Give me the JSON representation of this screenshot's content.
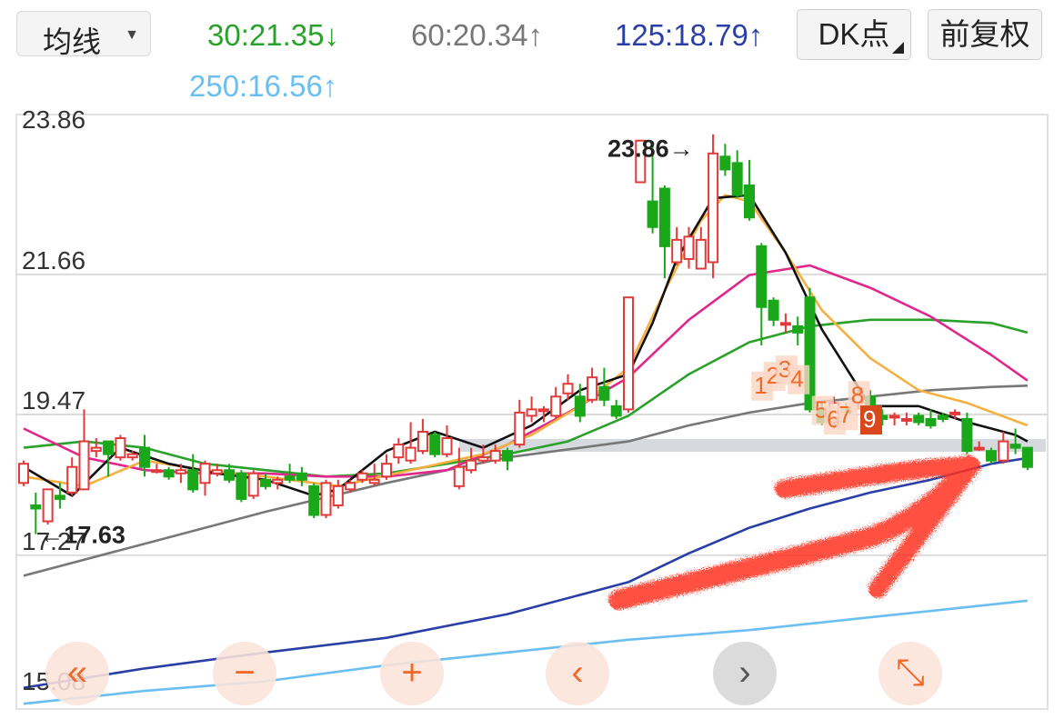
{
  "toolbar": {
    "indicator_select": {
      "label": "均线",
      "caret": "▼"
    },
    "ma": [
      {
        "label": "30:21.35↓",
        "color": "#2aa12a"
      },
      {
        "label": "60:20.34↑",
        "color": "#777777"
      },
      {
        "label": "125:18.79↑",
        "color": "#2a3fa6"
      },
      {
        "label": "250:16.56↑",
        "color": "#6bbff0"
      }
    ],
    "dk_button": "DK点",
    "adjust_button": "前复权"
  },
  "nav": [
    {
      "icon": "double-left-icon",
      "glyph": "«"
    },
    {
      "icon": "zoom-out-icon",
      "glyph": "−"
    },
    {
      "icon": "zoom-in-icon",
      "glyph": "+"
    },
    {
      "icon": "chevron-left-icon",
      "glyph": "‹"
    },
    {
      "icon": "chevron-right-icon",
      "glyph": "›"
    },
    {
      "icon": "expand-icon",
      "glyph": "⤡"
    }
  ],
  "chart_data": {
    "type": "candlestick",
    "y_ticks": [
      23.86,
      21.66,
      19.47,
      17.27,
      15.08
    ],
    "ylim": [
      15.08,
      23.86
    ],
    "grid": true,
    "colors": {
      "up": "#e03a3a",
      "down": "#1aa81a",
      "ma5": "#111111",
      "ma10": "#f5b040",
      "ma20": "#e0288c",
      "ma30": "#2aa12a",
      "ma60": "#777777",
      "ma125": "#2a3fa6",
      "ma250": "#6bbff0",
      "highlight": "#f06a2a",
      "arrow": "#ff3020"
    },
    "annotations": {
      "high": "23.86→",
      "low": "←17.63"
    },
    "td_labels": [
      {
        "text": "1",
        "n": 61,
        "y": 19.8,
        "style": "light"
      },
      {
        "text": "2",
        "n": 62,
        "y": 19.95,
        "style": "light"
      },
      {
        "text": "3",
        "n": 63,
        "y": 20.05,
        "style": "light"
      },
      {
        "text": "4",
        "n": 64,
        "y": 19.9,
        "style": "light"
      },
      {
        "text": "5",
        "n": 66,
        "y": 19.42,
        "style": "light"
      },
      {
        "text": "6",
        "n": 67,
        "y": 19.27,
        "style": "light"
      },
      {
        "text": "7",
        "n": 68,
        "y": 19.34,
        "style": "light"
      },
      {
        "text": "8",
        "n": 69,
        "y": 19.65,
        "style": "light"
      },
      {
        "text": "9",
        "n": 70,
        "y": 19.27,
        "style": "dark"
      }
    ],
    "candles": [
      [
        18.4,
        18.7,
        18.75,
        18.35
      ],
      [
        18.05,
        18.0,
        18.25,
        17.6
      ],
      [
        17.8,
        18.3,
        18.3,
        17.75
      ],
      [
        18.2,
        18.15,
        18.4,
        18.0
      ],
      [
        18.25,
        18.65,
        18.8,
        18.2
      ],
      [
        18.3,
        19.05,
        19.55,
        18.3
      ],
      [
        18.9,
        18.95,
        19.1,
        18.8
      ],
      [
        19.05,
        18.85,
        19.05,
        18.5
      ],
      [
        18.8,
        19.1,
        19.15,
        18.75
      ],
      [
        18.8,
        18.85,
        18.9,
        18.75
      ],
      [
        18.95,
        18.65,
        19.15,
        18.5
      ],
      [
        18.6,
        18.6,
        18.7,
        18.55
      ],
      [
        18.6,
        18.5,
        18.65,
        18.45
      ],
      [
        18.55,
        18.6,
        18.7,
        18.4
      ],
      [
        18.6,
        18.3,
        18.85,
        18.25
      ],
      [
        18.4,
        18.7,
        18.75,
        18.2
      ],
      [
        18.55,
        18.6,
        18.7,
        18.5
      ],
      [
        18.6,
        18.45,
        18.7,
        18.4
      ],
      [
        18.55,
        18.15,
        18.6,
        18.1
      ],
      [
        18.2,
        18.55,
        18.6,
        18.15
      ],
      [
        18.45,
        18.35,
        18.55,
        18.3
      ],
      [
        18.4,
        18.45,
        18.5,
        18.3
      ],
      [
        18.5,
        18.45,
        18.7,
        18.4
      ],
      [
        18.55,
        18.45,
        18.65,
        18.35
      ],
      [
        18.35,
        17.9,
        18.4,
        17.85
      ],
      [
        17.9,
        18.4,
        18.45,
        17.85
      ],
      [
        18.05,
        18.35,
        18.45,
        18.0
      ],
      [
        18.3,
        18.4,
        18.45,
        18.25
      ],
      [
        18.45,
        18.55,
        18.6,
        18.4
      ],
      [
        18.4,
        18.45,
        18.7,
        18.35
      ],
      [
        18.5,
        18.7,
        18.85,
        18.45
      ],
      [
        18.8,
        19.0,
        19.1,
        18.7
      ],
      [
        18.75,
        18.95,
        19.35,
        18.7
      ],
      [
        18.9,
        19.2,
        19.4,
        18.85
      ],
      [
        19.15,
        18.85,
        19.2,
        18.8
      ],
      [
        18.85,
        19.1,
        19.3,
        18.8
      ],
      [
        18.35,
        18.65,
        18.95,
        18.3
      ],
      [
        18.6,
        18.75,
        18.95,
        18.55
      ],
      [
        18.75,
        18.8,
        19.0,
        18.7
      ],
      [
        18.75,
        18.9,
        19.0,
        18.7
      ],
      [
        18.9,
        18.75,
        18.95,
        18.6
      ],
      [
        19.0,
        19.5,
        19.7,
        18.95
      ],
      [
        19.45,
        19.55,
        19.75,
        19.35
      ],
      [
        19.55,
        19.55,
        19.6,
        19.35
      ],
      [
        19.45,
        19.75,
        19.9,
        19.4
      ],
      [
        19.8,
        19.95,
        20.1,
        19.7
      ],
      [
        19.75,
        19.45,
        19.95,
        19.35
      ],
      [
        19.7,
        20.05,
        20.2,
        19.65
      ],
      [
        19.9,
        19.7,
        20.2,
        19.6
      ],
      [
        19.6,
        19.45,
        19.7,
        19.4
      ],
      [
        19.55,
        21.3,
        21.3,
        19.5
      ],
      [
        23.1,
        23.75,
        23.75,
        23.1
      ],
      [
        22.8,
        22.4,
        23.7,
        22.3
      ],
      [
        23.0,
        22.1,
        23.05,
        21.6
      ],
      [
        21.85,
        22.2,
        22.4,
        21.8
      ],
      [
        21.9,
        22.25,
        22.4,
        21.75
      ],
      [
        21.75,
        22.2,
        22.4,
        21.85
      ],
      [
        21.85,
        23.55,
        23.85,
        21.6
      ],
      [
        23.5,
        23.3,
        23.7,
        23.2
      ],
      [
        23.4,
        22.9,
        23.6,
        22.85
      ],
      [
        23.05,
        22.55,
        23.45,
        22.5
      ],
      [
        22.1,
        21.15,
        22.15,
        20.55
      ],
      [
        21.25,
        20.95,
        21.3,
        20.85
      ],
      [
        20.9,
        20.9,
        21.05,
        20.75
      ],
      [
        20.85,
        20.75,
        21.0,
        20.55
      ],
      [
        21.3,
        19.55,
        21.45,
        19.5
      ],
      [
        19.55,
        19.35,
        19.65,
        19.3
      ],
      [
        19.35,
        19.65,
        19.75,
        19.25
      ],
      [
        19.55,
        19.5,
        19.65,
        19.45
      ],
      [
        19.65,
        19.8,
        19.85,
        19.55
      ],
      [
        19.75,
        19.55,
        19.85,
        19.45
      ],
      [
        19.45,
        19.4,
        19.55,
        19.3
      ],
      [
        19.45,
        19.45,
        19.5,
        19.3
      ],
      [
        19.4,
        19.4,
        19.5,
        19.3
      ],
      [
        19.45,
        19.35,
        19.5,
        19.3
      ],
      [
        19.4,
        19.3,
        19.55,
        19.25
      ],
      [
        19.45,
        19.4,
        19.5,
        19.35
      ],
      [
        19.5,
        19.5,
        19.55,
        19.4
      ],
      [
        19.4,
        18.9,
        19.5,
        18.85
      ],
      [
        18.95,
        18.95,
        19.05,
        18.9
      ],
      [
        18.9,
        18.75,
        18.95,
        18.7
      ],
      [
        18.75,
        19.05,
        19.2,
        18.7
      ],
      [
        19.0,
        18.95,
        19.25,
        18.85
      ],
      [
        18.95,
        18.65,
        18.95,
        18.6
      ]
    ],
    "series": [
      {
        "name": "ma5",
        "x": [
          0,
          4,
          8,
          12,
          16,
          20,
          24,
          26,
          30,
          34,
          38,
          42,
          46,
          50,
          52,
          54,
          57,
          60,
          63,
          66,
          70,
          74,
          78,
          82,
          83
        ],
        "values": [
          18.65,
          18.2,
          18.95,
          18.7,
          18.55,
          18.45,
          18.2,
          18.3,
          18.9,
          19.2,
          18.95,
          19.3,
          19.85,
          20.1,
          20.9,
          21.9,
          22.85,
          22.9,
          22.0,
          20.8,
          19.6,
          19.6,
          19.35,
          19.15,
          19.05
        ]
      },
      {
        "name": "ma10",
        "x": [
          0,
          5,
          10,
          15,
          20,
          26,
          32,
          38,
          42,
          46,
          50,
          53,
          56,
          58,
          60,
          63,
          66,
          70,
          74,
          78,
          83
        ],
        "values": [
          18.5,
          18.35,
          18.75,
          18.6,
          18.5,
          18.35,
          18.6,
          18.85,
          19.15,
          19.6,
          20.2,
          21.4,
          22.5,
          22.9,
          22.8,
          22.0,
          21.1,
          20.35,
          19.85,
          19.65,
          19.3
        ]
      },
      {
        "name": "ma20",
        "x": [
          0,
          5,
          10,
          15,
          20,
          25,
          30,
          35,
          40,
          45,
          50,
          55,
          60,
          65,
          70,
          75,
          80,
          83
        ],
        "values": [
          19.25,
          18.8,
          18.6,
          18.55,
          18.55,
          18.5,
          18.5,
          18.6,
          19.0,
          19.5,
          20.05,
          20.95,
          21.65,
          21.8,
          21.45,
          21.0,
          20.4,
          20.0
        ]
      },
      {
        "name": "ma30",
        "x": [
          0,
          5,
          10,
          15,
          20,
          25,
          30,
          35,
          40,
          45,
          50,
          55,
          60,
          65,
          70,
          75,
          80,
          83
        ],
        "values": [
          18.95,
          19.05,
          18.95,
          18.7,
          18.6,
          18.5,
          18.55,
          18.7,
          18.85,
          19.05,
          19.45,
          20.1,
          20.6,
          20.85,
          20.95,
          20.95,
          20.9,
          20.75
        ]
      },
      {
        "name": "ma60",
        "x": [
          0,
          10,
          20,
          30,
          40,
          50,
          55,
          60,
          65,
          70,
          75,
          80,
          83
        ],
        "values": [
          16.95,
          17.45,
          17.95,
          18.4,
          18.8,
          19.05,
          19.3,
          19.5,
          19.65,
          19.75,
          19.85,
          19.9,
          19.92
        ]
      },
      {
        "name": "ma125",
        "x": [
          0,
          10,
          20,
          30,
          40,
          50,
          55,
          60,
          65,
          70,
          75,
          80,
          83
        ],
        "values": [
          15.2,
          15.5,
          15.75,
          15.98,
          16.35,
          16.85,
          17.3,
          17.7,
          18.0,
          18.25,
          18.45,
          18.7,
          18.79
        ]
      },
      {
        "name": "ma250",
        "x": [
          0,
          10,
          20,
          30,
          40,
          50,
          60,
          70,
          80,
          83
        ],
        "values": [
          14.95,
          15.15,
          15.3,
          15.55,
          15.75,
          15.95,
          16.1,
          16.3,
          16.5,
          16.56
        ]
      }
    ]
  }
}
